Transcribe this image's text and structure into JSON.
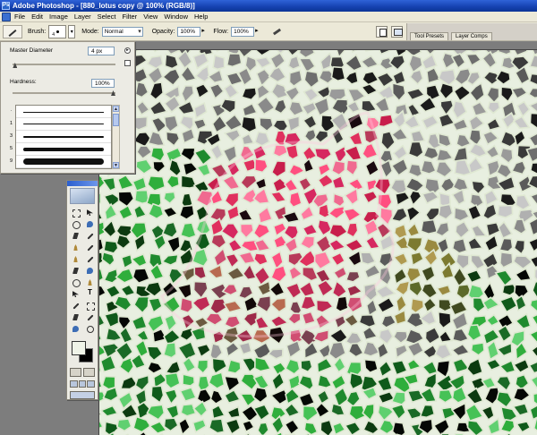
{
  "window": {
    "title": "Adobe Photoshop - [880_lotus copy @ 100% (RGB/8)]"
  },
  "menu": [
    "File",
    "Edit",
    "Image",
    "Layer",
    "Select",
    "Filter",
    "View",
    "Window",
    "Help"
  ],
  "options": {
    "brush_label": "Brush:",
    "brush_size_preview": "4",
    "mode_label": "Mode:",
    "mode_value": "Normal",
    "opacity_label": "Opacity:",
    "opacity_value": "100%",
    "flow_label": "Flow:",
    "flow_value": "100%"
  },
  "palette_well": {
    "tabs": [
      "Tool Presets",
      "Layer Comps"
    ]
  },
  "brush_panel": {
    "master_diameter_label": "Master Diameter",
    "master_diameter_value": "4 px",
    "hardness_label": "Hardness:",
    "hardness_value": "100%",
    "hardness_fraction": 1.0,
    "diameter_fraction": 0.02,
    "brushes": [
      {
        "num": "1"
      },
      {
        "num": "3"
      },
      {
        "num": "5"
      },
      {
        "num": "9"
      }
    ]
  },
  "colors": {
    "foreground": "#f0f4e8",
    "background": "#000000",
    "title_bar": "#1541b0"
  },
  "document": {
    "subject": "lotus mosaic"
  }
}
